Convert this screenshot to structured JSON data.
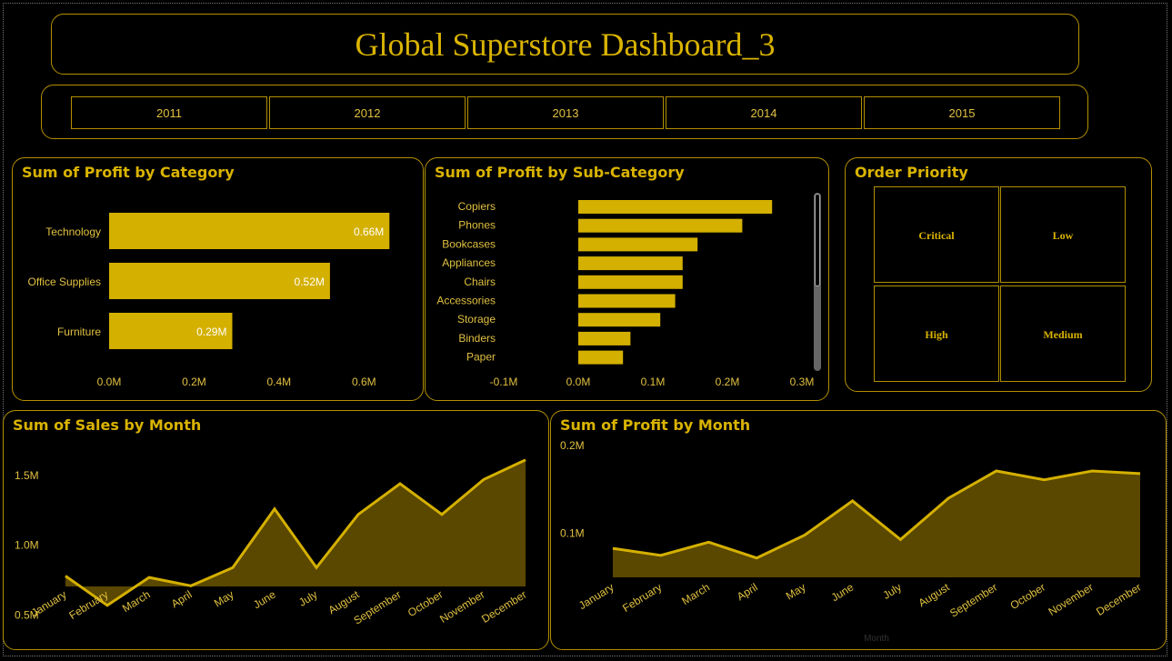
{
  "title": "Global Superstore Dashboard_3",
  "years": [
    "2011",
    "2012",
    "2013",
    "2014",
    "2015"
  ],
  "colors": {
    "accent": "#d9b300",
    "bar": "#d4b000",
    "area_fill": "#5a4700",
    "border": "#b38f00"
  },
  "profit_by_category": {
    "title": "Sum of Profit by Category",
    "chart_data": {
      "type": "bar",
      "orientation": "horizontal",
      "categories": [
        "Technology",
        "Office Supplies",
        "Furniture"
      ],
      "values": [
        0.66,
        0.52,
        0.29
      ],
      "value_labels": [
        "0.66M",
        "0.52M",
        "0.29M"
      ],
      "ticks": [
        "0.0M",
        "0.2M",
        "0.4M",
        "0.6M"
      ],
      "xlim": [
        0,
        0.7
      ]
    }
  },
  "profit_by_subcategory": {
    "title": "Sum of Profit by Sub-Category",
    "chart_data": {
      "type": "bar",
      "orientation": "horizontal",
      "categories": [
        "Copiers",
        "Phones",
        "Bookcases",
        "Appliances",
        "Chairs",
        "Accessories",
        "Storage",
        "Binders",
        "Paper"
      ],
      "values": [
        0.26,
        0.22,
        0.16,
        0.14,
        0.14,
        0.13,
        0.11,
        0.07,
        0.06
      ],
      "ticks": [
        "-0.1M",
        "0.0M",
        "0.1M",
        "0.2M",
        "0.3M"
      ],
      "xlim": [
        -0.1,
        0.3
      ]
    }
  },
  "order_priority": {
    "title": "Order Priority",
    "items": [
      "Critical",
      "Low",
      "High",
      "Medium"
    ]
  },
  "sales_by_month": {
    "title": "Sum of Sales by Month",
    "chart_data": {
      "type": "area",
      "categories": [
        "January",
        "February",
        "March",
        "April",
        "May",
        "June",
        "July",
        "August",
        "September",
        "October",
        "November",
        "December"
      ],
      "values": [
        0.78,
        0.57,
        0.77,
        0.71,
        0.84,
        1.26,
        0.84,
        1.22,
        1.44,
        1.22,
        1.47,
        1.61
      ],
      "ticks": [
        "0.5M",
        "1.0M",
        "1.5M"
      ],
      "ylim": [
        0.4,
        1.7
      ]
    }
  },
  "profit_by_month": {
    "title": "Sum of Profit by Month",
    "xlabel": "Month",
    "chart_data": {
      "type": "area",
      "categories": [
        "January",
        "February",
        "March",
        "April",
        "May",
        "June",
        "July",
        "August",
        "September",
        "October",
        "November",
        "December"
      ],
      "values": [
        0.083,
        0.075,
        0.09,
        0.072,
        0.098,
        0.137,
        0.093,
        0.14,
        0.171,
        0.161,
        0.171,
        0.168
      ],
      "ticks": [
        "0.1M",
        "0.2M"
      ],
      "ylim": [
        0.05,
        0.2
      ]
    }
  }
}
